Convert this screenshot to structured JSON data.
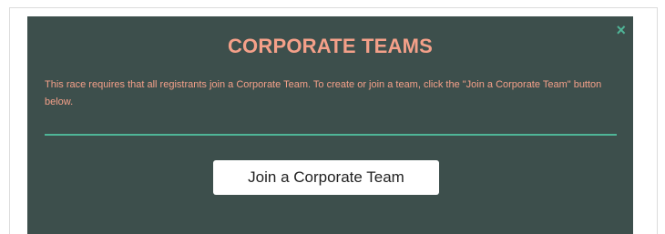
{
  "modal": {
    "title": "CORPORATE TEAMS",
    "description": "This race requires that all registrants join a Corporate Team. To create or join a team, click the \"Join a Corporate Team\" button below.",
    "close_label": "×",
    "join_button_label": "Join a Corporate Team"
  },
  "colors": {
    "modal_background": "#3d4f4c",
    "accent_text": "#f4a089",
    "divider": "#4fb597",
    "close_icon": "#4fb597",
    "button_background": "#ffffff"
  },
  "icons": {
    "close": "close-icon"
  }
}
